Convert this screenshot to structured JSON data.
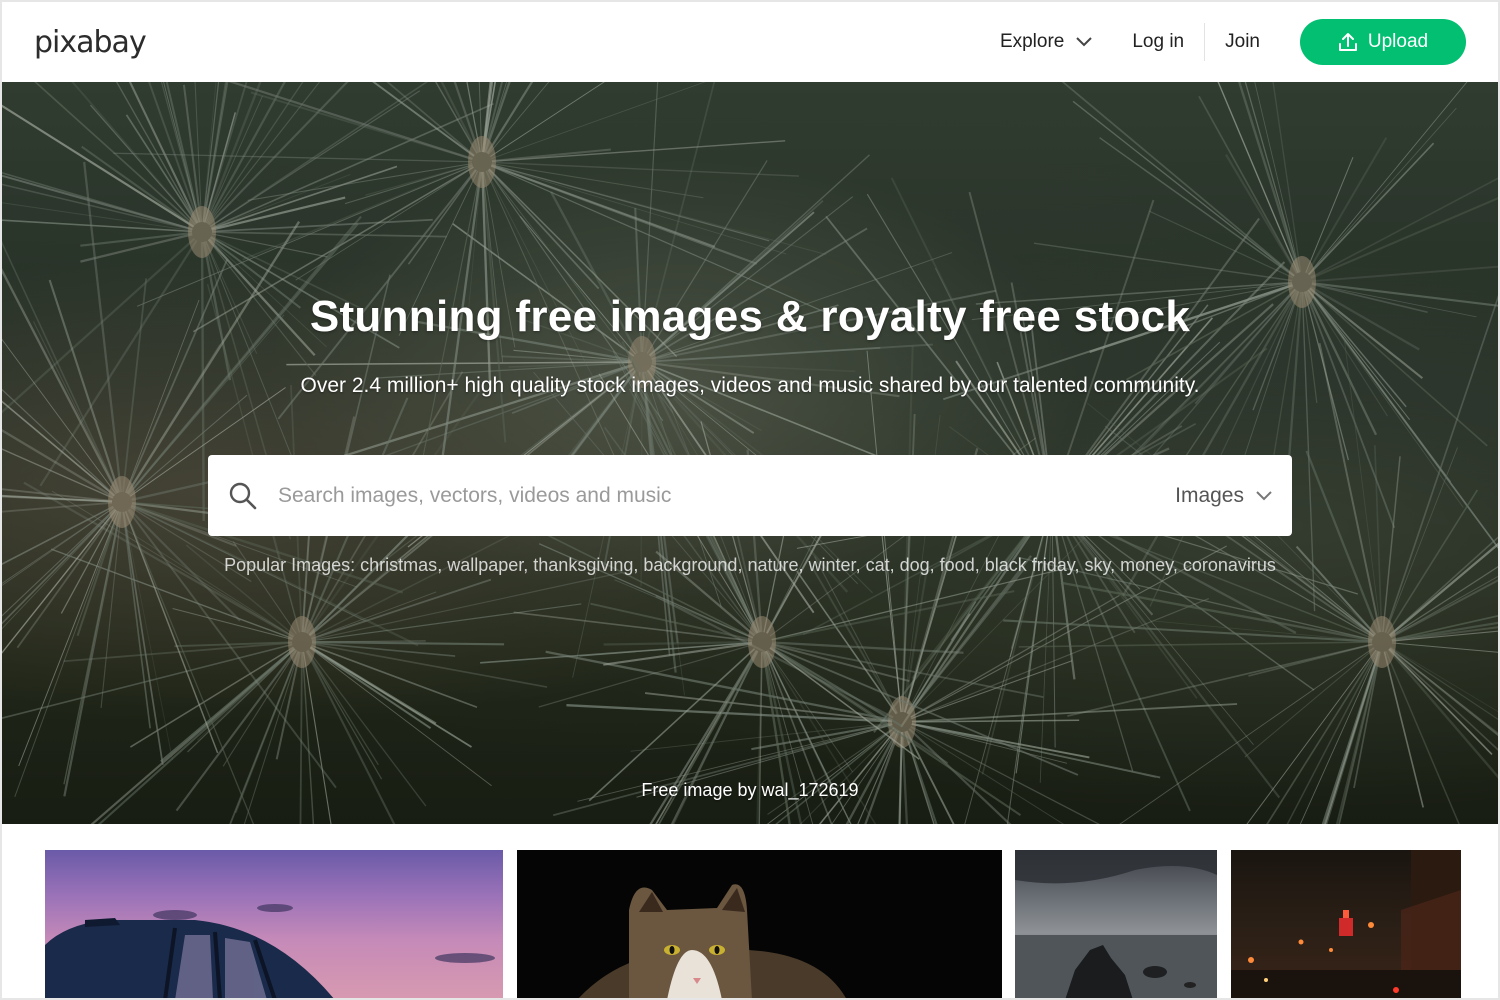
{
  "header": {
    "logo": "pixabay",
    "nav": {
      "explore": "Explore",
      "login": "Log in",
      "join": "Join",
      "upload": "Upload"
    }
  },
  "hero": {
    "title": "Stunning free images & royalty free stock",
    "subtitle": "Over 2.4 million+ high quality stock images, videos and music shared by our talented community.",
    "search": {
      "placeholder": "Search images, vectors, videos and music",
      "type": "Images"
    },
    "popular": {
      "label": "Popular Images:",
      "tags": [
        "christmas",
        "wallpaper",
        "thanksgiving",
        "background",
        "nature",
        "winter",
        "cat",
        "dog",
        "food",
        "black friday",
        "sky",
        "money",
        "coronavirus"
      ]
    },
    "credit": "Free image by wal_172619"
  },
  "colors": {
    "accent": "#02bf72"
  },
  "icons": {
    "upload": "upload-icon",
    "search": "search-icon",
    "chevron": "chevron-down-icon"
  }
}
